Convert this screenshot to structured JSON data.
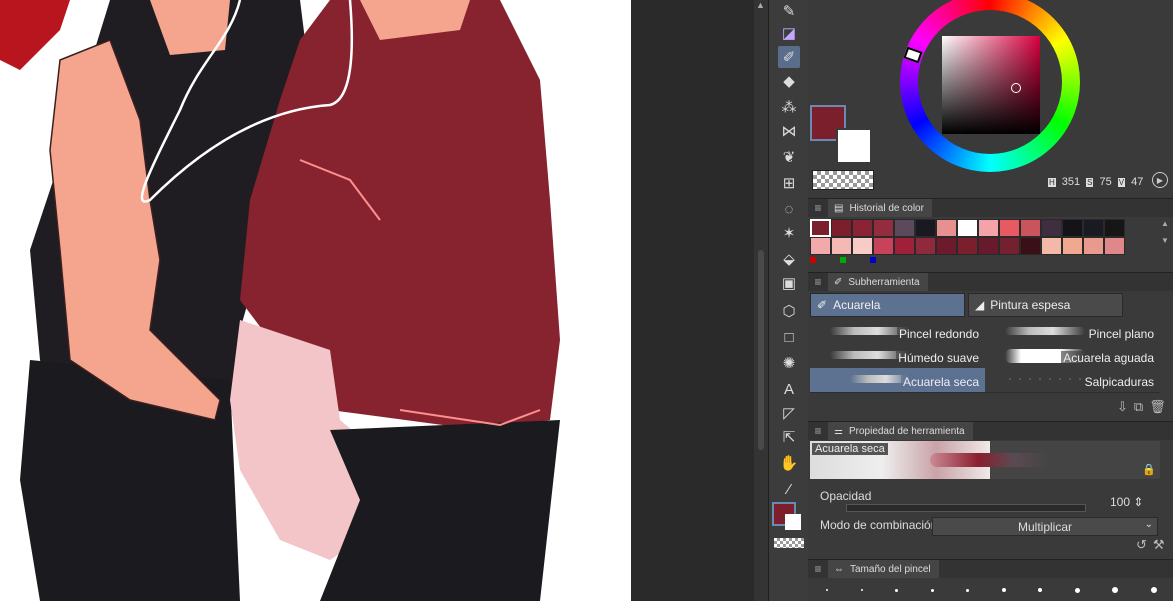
{
  "canvas": {
    "description_label": "canvas"
  },
  "color": {
    "main": "#7a1f2b",
    "sub": "#ffffff",
    "hue": "351",
    "saturation": "75",
    "value": "47",
    "hsv_labels": [
      "H",
      "S",
      "V"
    ]
  },
  "color_history": {
    "tab_label": "Historial de color",
    "row1": [
      "#7a1f2b",
      "#7a1f2b",
      "#8a2434",
      "#922c3e",
      "#5c4a5c",
      "#1a1820",
      "#e89090",
      "#ffffff",
      "#f3a3a9",
      "#e85a62",
      "#c9545c",
      "#3e2e40",
      "#141418",
      "#1a1a22",
      "#161616"
    ],
    "row2": [
      "#f2a9aa",
      "#f5b9b5",
      "#f8ccc6",
      "#c8425a",
      "#a0203a",
      "#8e2a3c",
      "#6e1a2e",
      "#7a1f2b",
      "#681a2c",
      "#74202e",
      "#3a1018",
      "#f4b8a8",
      "#f1a890",
      "#e89a8c",
      "#e0878a"
    ]
  },
  "subtool": {
    "tab_label": "Subherramienta",
    "groups": [
      {
        "label": "Acuarela",
        "active": true
      },
      {
        "label": "Pintura espesa",
        "active": false
      }
    ],
    "brushes": [
      [
        "Pincel redondo",
        "Pincel plano"
      ],
      [
        "Húmedo suave",
        "Acuarela aguada"
      ],
      [
        "Acuarela seca",
        "Salpicaduras"
      ]
    ]
  },
  "tool_property": {
    "tab_label": "Propiedad de herramienta",
    "brush_name": "Acuarela seca",
    "opacity_label": "Opacidad",
    "opacity_value": "100",
    "blend_label": "Modo de combinación",
    "blend_value": "Multiplicar"
  },
  "brush_size": {
    "tab_label": "Tamaño del pincel"
  }
}
